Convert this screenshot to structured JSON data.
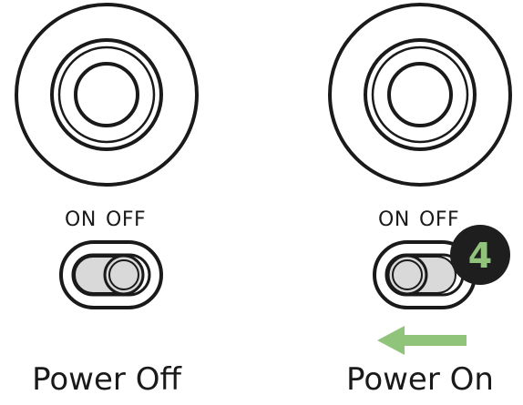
{
  "panels": [
    {
      "id": "power-off",
      "switch_labels": {
        "on": "ON",
        "off": "OFF"
      },
      "caption": "Power Off",
      "switch_position": "off"
    },
    {
      "id": "power-on",
      "switch_labels": {
        "on": "ON",
        "off": "OFF"
      },
      "caption": "Power On",
      "switch_position": "on",
      "step_badge": "4",
      "arrow_direction": "left"
    }
  ],
  "colors": {
    "line": "#1a1a1a",
    "knob_fill": "#d9d9d9",
    "badge_bg": "#1e1e1e",
    "badge_text": "#8fc47a",
    "arrow": "#8fc47a"
  }
}
